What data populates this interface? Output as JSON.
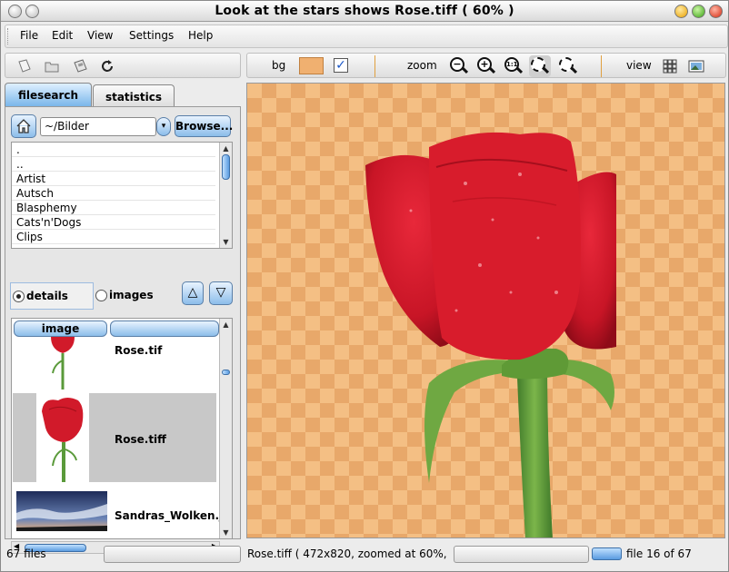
{
  "window": {
    "title": "Look at the stars shows Rose.tiff ( 60% )"
  },
  "menu": [
    "File",
    "Edit",
    "View",
    "Settings",
    "Help"
  ],
  "toolbar": {
    "bg_label": "bg",
    "zoom_label": "zoom",
    "view_label": "view",
    "bg_color": "#f0b070",
    "zoom_icons": [
      "zoom-out-icon",
      "zoom-in-icon",
      "zoom-1-1-icon",
      "zoom-fit-icon",
      "zoom-fit-width-icon"
    ],
    "zoom_glyphs": [
      "−",
      "+",
      "1:1",
      "",
      ""
    ]
  },
  "tabs": {
    "filesearch": "filesearch",
    "statistics": "statistics"
  },
  "filesearch": {
    "path": "~/Bilder",
    "browse_label": "Browse...",
    "dirs": [
      ".",
      "..",
      "Artist",
      "Autsch",
      "Blasphemy",
      "Cats'n'Dogs",
      "Clips"
    ],
    "mode_details": "details",
    "mode_images": "images",
    "column_image": "image",
    "column_name": "",
    "files": [
      "Rose.tif",
      "Rose.tiff",
      "Sandras_Wolken.jpg"
    ]
  },
  "status": {
    "file_count": "67 files",
    "image_info": "Rose.tiff ( 472x820, zoomed at 60%,",
    "file_position": "file 16 of 67"
  },
  "colors": {
    "accent": "#7ab6ea",
    "canvas_light": "#f4bf84",
    "canvas_dark": "#e8a86a",
    "rose": "#d11a2a"
  }
}
